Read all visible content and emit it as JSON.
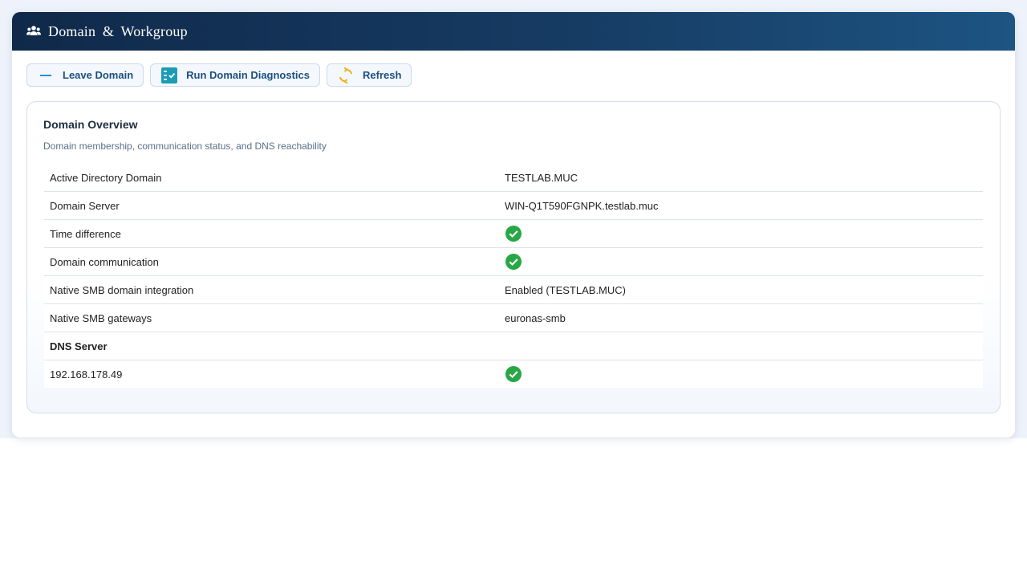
{
  "window": {
    "title": "Domain & Workgroup",
    "title_icon": "users-group-icon"
  },
  "toolbar": {
    "leave_label": "Leave Domain",
    "diagnostics_label": "Run Domain Diagnostics",
    "refresh_label": "Refresh"
  },
  "card": {
    "title": "Domain Overview",
    "subtitle": "Domain membership, communication status, and DNS reachability"
  },
  "rows": [
    {
      "label": "Active Directory Domain",
      "value": "TESTLAB.MUC"
    },
    {
      "label": "Domain Server",
      "value": "WIN-Q1T590FGNPK.testlab.muc"
    },
    {
      "label": "Time difference",
      "status": "ok"
    },
    {
      "label": "Domain communication",
      "status": "ok"
    },
    {
      "label": "Native SMB domain integration",
      "value": "Enabled (TESTLAB.MUC)"
    },
    {
      "label": "Native SMB gateways",
      "value": "euronas-smb"
    }
  ],
  "dns": {
    "heading": "DNS Server",
    "servers": [
      {
        "address": "192.168.178.49",
        "status": "ok"
      }
    ]
  },
  "colors": {
    "accent": "#1d4f7f",
    "status_ok": "#27a745",
    "diagnostics_icon": "#1b9bb5",
    "refresh_icon": "#f2b01e",
    "leave_icon": "#2a8fd8"
  }
}
